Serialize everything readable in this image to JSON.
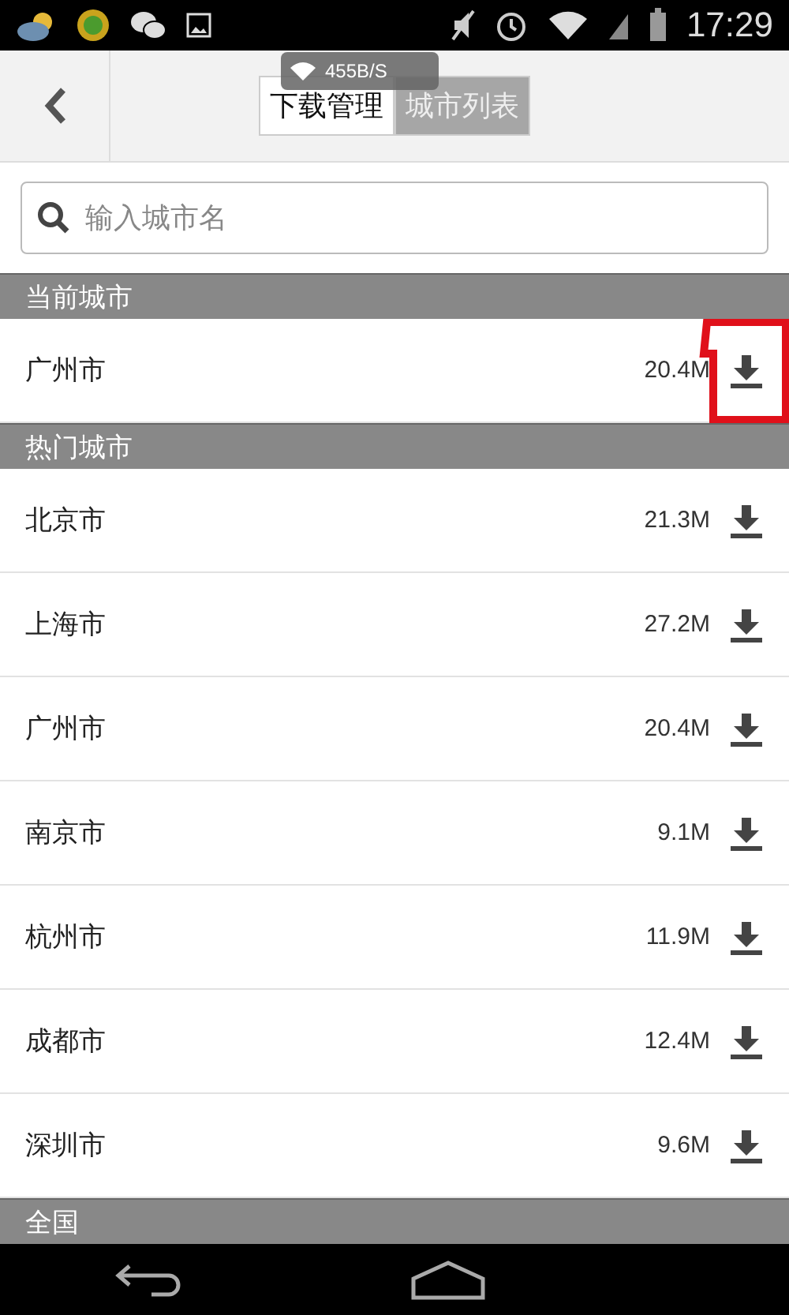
{
  "status_bar": {
    "time": "17:29"
  },
  "speed_toast": {
    "text": "455B/S"
  },
  "tabs": [
    {
      "label": "下载管理",
      "selected": true
    },
    {
      "label": "城市列表",
      "selected": false
    }
  ],
  "search": {
    "placeholder": "输入城市名"
  },
  "current_section": {
    "title": "当前城市",
    "city": {
      "name": "广州市",
      "size": "20.4M",
      "highlighted": true
    }
  },
  "hot_section": {
    "title": "热门城市",
    "cities": [
      {
        "name": "北京市",
        "size": "21.3M"
      },
      {
        "name": "上海市",
        "size": "27.2M"
      },
      {
        "name": "广州市",
        "size": "20.4M"
      },
      {
        "name": "南京市",
        "size": "9.1M"
      },
      {
        "name": "杭州市",
        "size": "11.9M"
      },
      {
        "name": "成都市",
        "size": "12.4M"
      },
      {
        "name": "深圳市",
        "size": "9.6M"
      }
    ]
  },
  "next_section": {
    "title": "全国"
  }
}
